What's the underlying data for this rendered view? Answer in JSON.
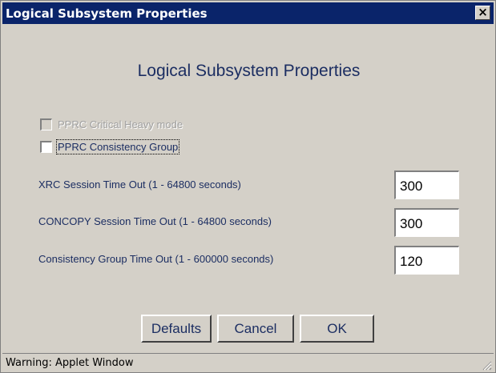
{
  "window": {
    "title": "Logical Subsystem Properties",
    "close_glyph": "×"
  },
  "heading": "Logical Subsystem Properties",
  "checkboxes": [
    {
      "label": "PPRC Critical Heavy mode",
      "checked": false,
      "enabled": false
    },
    {
      "label": "PPRC Consistency Group",
      "checked": false,
      "enabled": true,
      "focused": true
    }
  ],
  "fields": [
    {
      "label": "XRC Session Time Out (1 - 64800 seconds)",
      "value": "300"
    },
    {
      "label": "CONCOPY Session Time Out (1 - 64800 seconds)",
      "value": "300"
    },
    {
      "label": "Consistency Group Time Out (1 - 600000 seconds)",
      "value": "120"
    }
  ],
  "buttons": {
    "defaults": "Defaults",
    "cancel": "Cancel",
    "ok": "OK"
  },
  "status": "Warning: Applet Window",
  "colors": {
    "titlebar": "#0a246a",
    "face": "#d4d0c8",
    "text": "#1c2e62"
  }
}
